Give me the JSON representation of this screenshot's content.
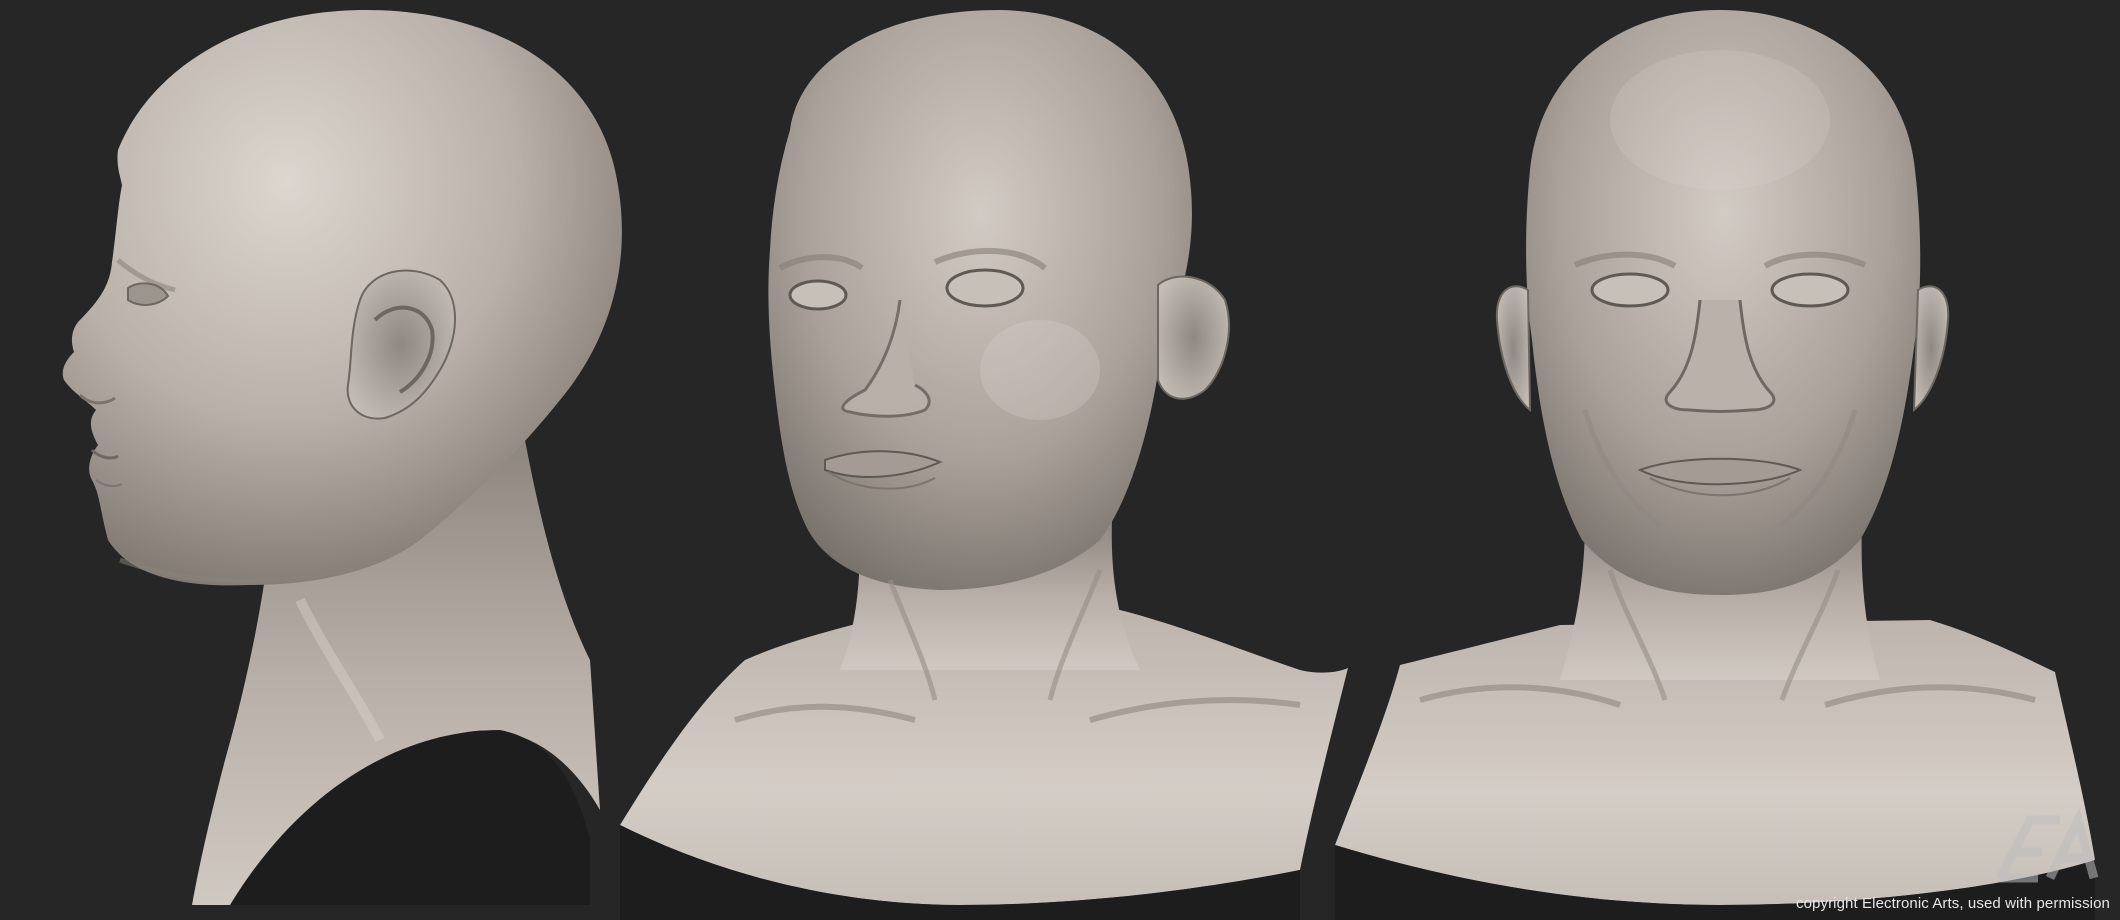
{
  "render": {
    "views": [
      "side-profile",
      "three-quarter",
      "front"
    ]
  },
  "watermark": {
    "logo_text": "EA",
    "copyright": "copyright Electronic Arts, used with permission"
  },
  "colors": {
    "background": "#262626",
    "skin_light": "#d4cdc6",
    "skin_mid": "#a69e96",
    "skin_dark": "#6d6761"
  }
}
